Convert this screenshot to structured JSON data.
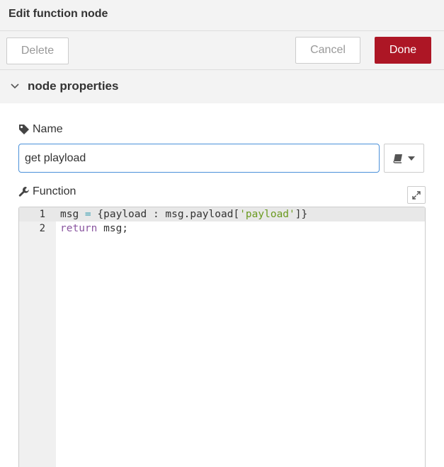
{
  "header": {
    "title": "Edit function node"
  },
  "toolbar": {
    "delete_label": "Delete",
    "cancel_label": "Cancel",
    "done_label": "Done"
  },
  "section": {
    "title": "node properties"
  },
  "form": {
    "name_label": "Name",
    "name_value": "get playload",
    "function_label": "Function"
  },
  "editor": {
    "line_numbers": [
      "1",
      "2"
    ],
    "line1": {
      "a": "msg",
      "b": " = ",
      "c": "{payload : msg.payload[",
      "d": "'payload'",
      "e": "]}"
    },
    "line2": {
      "a": "return",
      "b": " msg;"
    }
  },
  "colors": {
    "done_button": "#ad1625",
    "input_focus_border": "#4a90d9",
    "code_string": "#6a9a1f",
    "code_keyword": "#8a56a0",
    "code_operator": "#3a9fb2"
  },
  "icons": [
    "tag-icon",
    "wrench-icon",
    "book-icon",
    "caret-down-icon",
    "expand-icon",
    "chevron-down-icon"
  ]
}
